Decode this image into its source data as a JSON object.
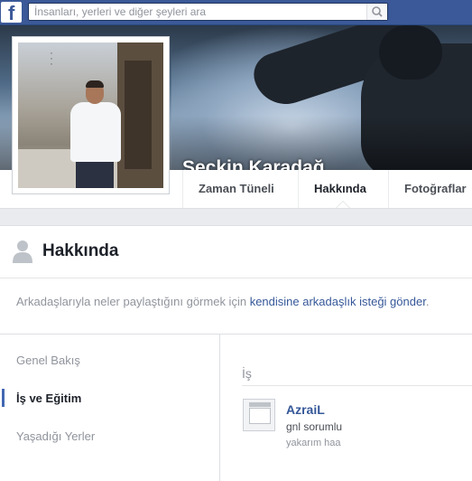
{
  "search": {
    "placeholder": "İnsanları, yerleri ve diğer şeyleri ara"
  },
  "profile": {
    "name": "Seçkin Karadağ"
  },
  "tabs": [
    {
      "label": "Zaman Tüneli"
    },
    {
      "label": "Hakkında"
    },
    {
      "label": "Fotoğraflar"
    }
  ],
  "about": {
    "title": "Hakkında",
    "notice_text": "Arkadaşlarıyla neler paylaştığını görmek için ",
    "notice_link": "kendisine arkadaşlık isteği gönder",
    "notice_end": "."
  },
  "sidenav": [
    {
      "label": "Genel Bakış"
    },
    {
      "label": "İş ve Eğitim"
    },
    {
      "label": "Yaşadığı Yerler"
    }
  ],
  "work": {
    "section_title": "İş",
    "employer": "AzraiL",
    "position": "gnl sorumlu",
    "description": "yakarım haa"
  },
  "colors": {
    "brand": "#3b5998",
    "link": "#365899",
    "active_indicator": "#4267b2"
  }
}
